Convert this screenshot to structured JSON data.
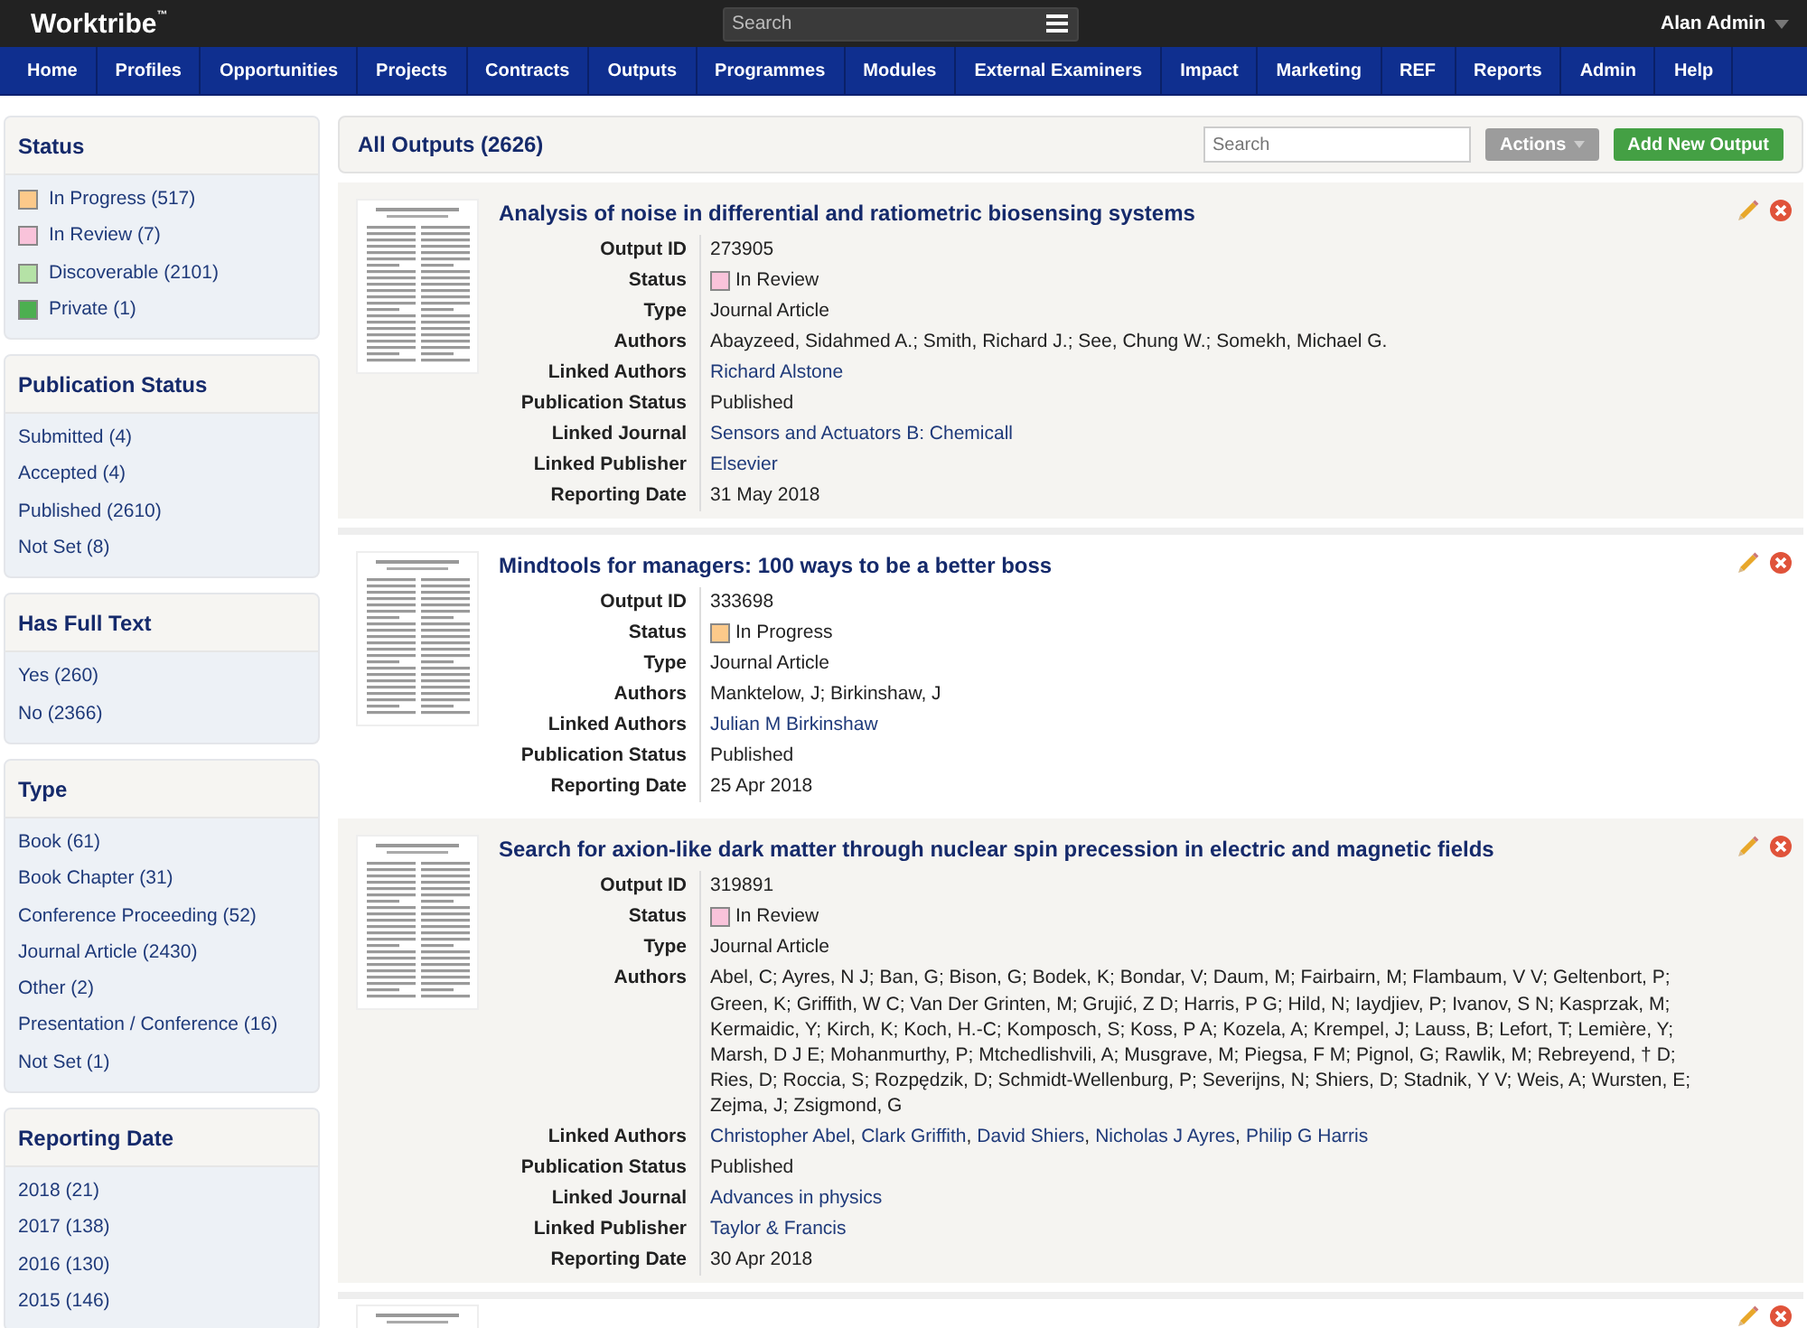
{
  "header": {
    "logo": "Worktribe",
    "logo_mark": "™",
    "search_placeholder": "Search",
    "user": "Alan Admin"
  },
  "nav": [
    "Home",
    "Profiles",
    "Opportunities",
    "Projects",
    "Contracts",
    "Outputs",
    "Programmes",
    "Modules",
    "External Examiners",
    "Impact",
    "Marketing",
    "REF",
    "Reports",
    "Admin",
    "Help"
  ],
  "sidebar": [
    {
      "title": "Status",
      "items": [
        {
          "label": "In Progress (517)",
          "color": "#fcc98a"
        },
        {
          "label": "In Review (7)",
          "color": "#f9c3da"
        },
        {
          "label": "Discoverable (2101)",
          "color": "#b5e2a6"
        },
        {
          "label": "Private (1)",
          "color": "#4caf50"
        }
      ]
    },
    {
      "title": "Publication Status",
      "items": [
        {
          "label": "Submitted (4)"
        },
        {
          "label": "Accepted (4)"
        },
        {
          "label": "Published (2610)"
        },
        {
          "label": "Not Set (8)"
        }
      ]
    },
    {
      "title": "Has Full Text",
      "items": [
        {
          "label": "Yes (260)"
        },
        {
          "label": "No (2366)"
        }
      ]
    },
    {
      "title": "Type",
      "items": [
        {
          "label": "Book (61)"
        },
        {
          "label": "Book Chapter (31)"
        },
        {
          "label": "Conference Proceeding (52)"
        },
        {
          "label": "Journal Article (2430)"
        },
        {
          "label": "Other (2)"
        },
        {
          "label": "Presentation / Conference (16)"
        },
        {
          "label": "Not Set (1)"
        }
      ]
    },
    {
      "title": "Reporting Date",
      "items": [
        {
          "label": "2018 (21)"
        },
        {
          "label": "2017 (138)"
        },
        {
          "label": "2016 (130)"
        },
        {
          "label": "2015 (146)"
        }
      ]
    }
  ],
  "toolbar": {
    "title": "All Outputs (2626)",
    "search_placeholder": "Search",
    "actions": "Actions",
    "add_button": "Add New Output"
  },
  "outputs": [
    {
      "title": "Analysis of noise in differential and ratiometric biosensing systems",
      "fields": [
        {
          "kind": "text",
          "label": "Output ID",
          "value": "273905"
        },
        {
          "kind": "status",
          "label": "Status",
          "value": "In Review",
          "color": "#f9c3da"
        },
        {
          "kind": "text",
          "label": "Type",
          "value": "Journal Article"
        },
        {
          "kind": "text",
          "label": "Authors",
          "value": "Abayzeed, Sidahmed A.; Smith, Richard J.; See, Chung W.; Somekh, Michael G."
        },
        {
          "kind": "links",
          "label": "Linked Authors",
          "links": [
            "Richard Alstone"
          ]
        },
        {
          "kind": "text",
          "label": "Publication Status",
          "value": "Published"
        },
        {
          "kind": "links",
          "label": "Linked Journal",
          "links": [
            "Sensors and Actuators B: Chemicall"
          ]
        },
        {
          "kind": "links",
          "label": "Linked Publisher",
          "links": [
            "Elsevier"
          ]
        },
        {
          "kind": "text",
          "label": "Reporting Date",
          "value": "31 May 2018"
        }
      ]
    },
    {
      "title": "Mindtools for managers: 100 ways to be a better boss",
      "fields": [
        {
          "kind": "text",
          "label": "Output ID",
          "value": "333698"
        },
        {
          "kind": "status",
          "label": "Status",
          "value": "In Progress",
          "color": "#fcc98a"
        },
        {
          "kind": "text",
          "label": "Type",
          "value": "Journal Article"
        },
        {
          "kind": "text",
          "label": "Authors",
          "value": "Manktelow, J; Birkinshaw, J"
        },
        {
          "kind": "links",
          "label": "Linked Authors",
          "links": [
            "Julian M Birkinshaw"
          ]
        },
        {
          "kind": "text",
          "label": "Publication Status",
          "value": "Published"
        },
        {
          "kind": "text",
          "label": "Reporting Date",
          "value": "25 Apr 2018"
        }
      ]
    },
    {
      "title": "Search for axion-like dark matter through nuclear spin precession in electric and magnetic fields",
      "fields": [
        {
          "kind": "text",
          "label": "Output ID",
          "value": "319891"
        },
        {
          "kind": "status",
          "label": "Status",
          "value": "In Review",
          "color": "#f9c3da"
        },
        {
          "kind": "text",
          "label": "Type",
          "value": "Journal Article"
        },
        {
          "kind": "text",
          "label": "Authors",
          "value": "Abel, C; Ayres, N J; Ban, G; Bison, G; Bodek, K; Bondar, V; Daum, M; Fairbairn, M; Flambaum, V V; Geltenbort, P; Green, K; Griffith, W C; Van Der Grinten, M; Grujić, Z D; Harris, P G; Hild, N; Iaydjiev, P; Ivanov, S N; Kasprzak, M; Kermaidic, Y; Kirch, K; Koch, H.-C; Komposch, S; Koss, P A; Kozela, A; Krempel, J; Lauss, B; Lefort, T; Lemière, Y; Marsh, D J E; Mohanmurthy, P; Mtchedlishvili, A; Musgrave, M; Piegsa, F M; Pignol, G; Rawlik, M; Rebreyend, † D; Ries, D; Roccia, S; Rozpędzik, D; Schmidt-Wellenburg, P; Severijns, N; Shiers, D; Stadnik, Y V; Weis, A; Wursten, E; Zejma, J; Zsigmond, G"
        },
        {
          "kind": "links",
          "label": "Linked Authors",
          "links": [
            "Christopher Abel",
            "Clark Griffith",
            "David Shiers",
            "Nicholas J Ayres",
            "Philip G Harris"
          ],
          "separator": ","
        },
        {
          "kind": "text",
          "label": "Publication Status",
          "value": "Published"
        },
        {
          "kind": "links",
          "label": "Linked Journal",
          "links": [
            "Advances in physics"
          ]
        },
        {
          "kind": "links",
          "label": "Linked Publisher",
          "links": [
            "Taylor & Francis"
          ]
        },
        {
          "kind": "text",
          "label": "Reporting Date",
          "value": "30 Apr 2018"
        }
      ]
    }
  ],
  "more_below": true
}
